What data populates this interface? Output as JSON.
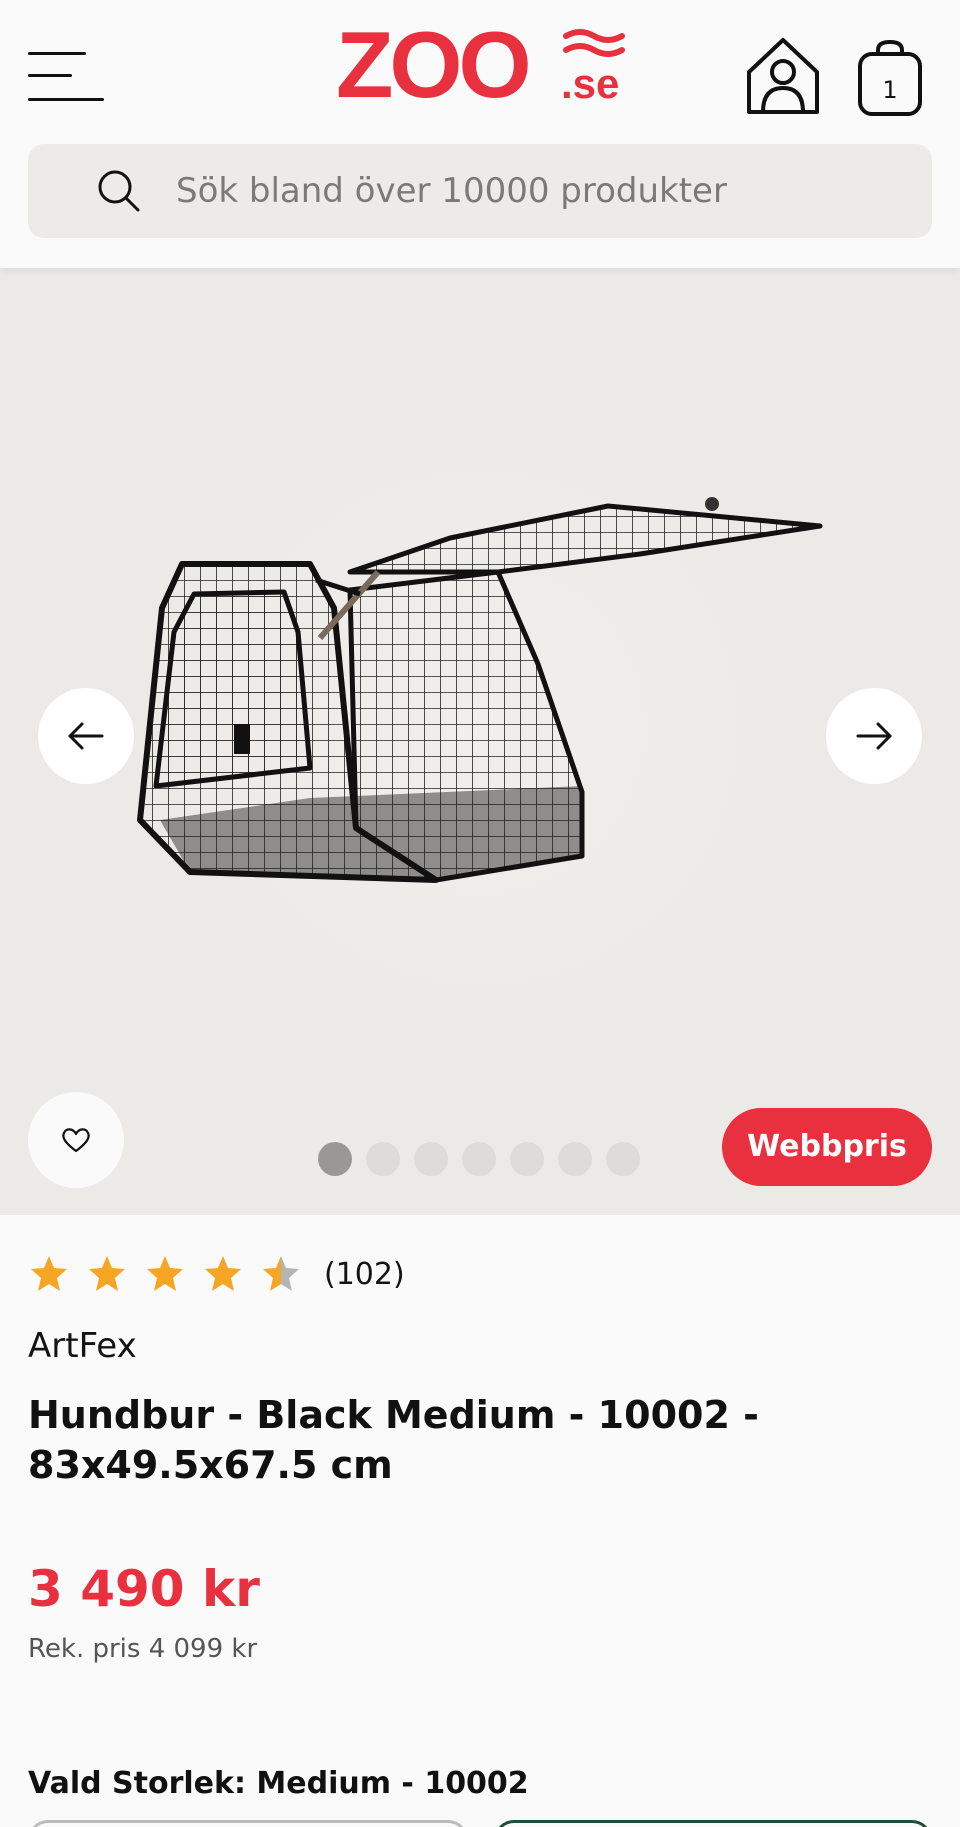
{
  "header": {
    "logo_text": "ZOO",
    "logo_suffix": ".se",
    "cart_count": "1"
  },
  "search": {
    "placeholder": "Sök bland över 10000 produkter"
  },
  "gallery": {
    "image_count": 7,
    "active_index": 0,
    "badge_label": "Webbpris"
  },
  "product": {
    "rating": 4.5,
    "rating_count": "(102)",
    "brand": "ArtFex",
    "title": "Hundbur - Black Medium - 10002 - 83x49.5x67.5 cm",
    "price": "3 490 kr",
    "rek_pris": "Rek. pris 4 099 kr",
    "selected_size_label": "Vald Storlek: Medium - 10002"
  },
  "colors": {
    "brand_red": "#e8303f",
    "star_gold": "#f5a623",
    "star_empty": "#b5b5b5",
    "selected_outline": "#1f4d3a"
  },
  "icons": [
    "menu-icon",
    "house-person-icon",
    "shopping-bag-icon",
    "search-icon",
    "arrow-left-icon",
    "arrow-right-icon",
    "heart-icon",
    "star-icon"
  ]
}
